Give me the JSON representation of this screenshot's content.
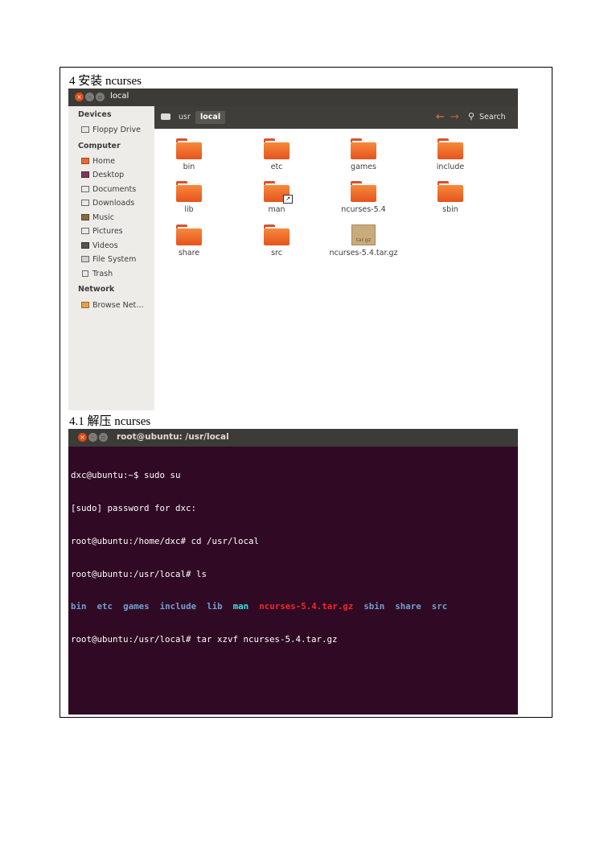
{
  "headings": {
    "install": "4 安装 ncurses",
    "extract": "4.1 解压 ncurses"
  },
  "file_manager": {
    "title": "local",
    "sidebar": {
      "devices_label": "Devices",
      "devices": [
        {
          "label": "Floppy Drive",
          "icon": "floppy-icon"
        }
      ],
      "computer_label": "Computer",
      "computer": [
        {
          "label": "Home",
          "icon": "home-icon"
        },
        {
          "label": "Desktop",
          "icon": "desktop-icon"
        },
        {
          "label": "Documents",
          "icon": "documents-icon"
        },
        {
          "label": "Downloads",
          "icon": "downloads-icon"
        },
        {
          "label": "Music",
          "icon": "music-icon"
        },
        {
          "label": "Pictures",
          "icon": "pictures-icon"
        },
        {
          "label": "Videos",
          "icon": "videos-icon"
        },
        {
          "label": "File System",
          "icon": "filesystem-icon"
        },
        {
          "label": "Trash",
          "icon": "trash-icon"
        }
      ],
      "network_label": "Network",
      "network": [
        {
          "label": "Browse Net…",
          "icon": "network-icon"
        }
      ]
    },
    "breadcrumbs": [
      "usr",
      "local"
    ],
    "search_label": "Search",
    "items": [
      {
        "name": "bin",
        "kind": "folder"
      },
      {
        "name": "etc",
        "kind": "folder"
      },
      {
        "name": "games",
        "kind": "folder"
      },
      {
        "name": "include",
        "kind": "folder"
      },
      {
        "name": "lib",
        "kind": "folder"
      },
      {
        "name": "man",
        "kind": "folder-link"
      },
      {
        "name": "ncurses-5.4",
        "kind": "folder"
      },
      {
        "name": "sbin",
        "kind": "folder"
      },
      {
        "name": "share",
        "kind": "folder"
      },
      {
        "name": "src",
        "kind": "folder"
      },
      {
        "name": "ncurses-5.4.tar.gz",
        "kind": "archive",
        "badge": "tar.gz"
      }
    ]
  },
  "terminal": {
    "title": "root@ubuntu: /usr/local",
    "lines": [
      "dxc@ubuntu:~$ sudo su",
      "[sudo] password for dxc:",
      "root@ubuntu:/home/dxc# cd /usr/local",
      "root@ubuntu:/usr/local# ls"
    ],
    "ls_output": [
      {
        "text": "bin",
        "type": "dir"
      },
      {
        "text": "etc",
        "type": "dir"
      },
      {
        "text": "games",
        "type": "dir"
      },
      {
        "text": "include",
        "type": "dir"
      },
      {
        "text": "lib",
        "type": "dir"
      },
      {
        "text": "man",
        "type": "link"
      },
      {
        "text": "ncurses-5.4.tar.gz",
        "type": "archive"
      },
      {
        "text": "sbin",
        "type": "dir"
      },
      {
        "text": "share",
        "type": "dir"
      },
      {
        "text": "src",
        "type": "dir"
      }
    ],
    "last_line": "root@ubuntu:/usr/local# tar xzvf ncurses-5.4.tar.gz"
  },
  "colors": {
    "terminal_bg": "#300a24",
    "folder_orange": "#f07233",
    "ls_dir": "#729fcf",
    "ls_link": "#34e2e2",
    "ls_archive": "#ef2929"
  }
}
